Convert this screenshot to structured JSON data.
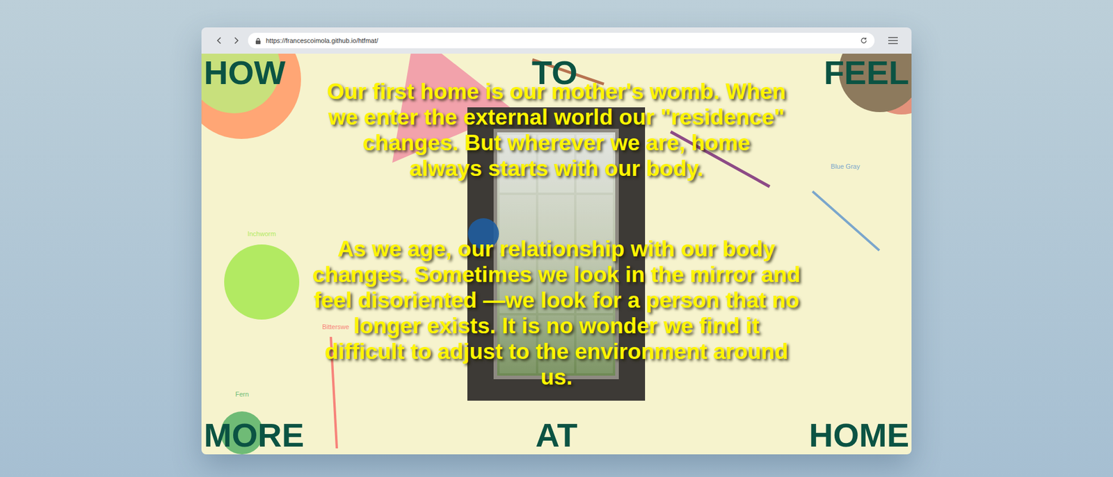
{
  "browser": {
    "url": "https://francescoimola.github.io/htfmat/"
  },
  "title_words": {
    "top": [
      "HOW",
      "TO",
      "FEEL"
    ],
    "bottom": [
      "MORE",
      "AT",
      "HOME"
    ]
  },
  "paragraphs": [
    "Our first home is our mother's womb. When we enter the external world our \"residence\" changes. But wherever we are, home always starts with our body.",
    "As we age, our relationship with our body changes. Sometimes we look in the mirror and feel disoriented —we look for a person that no longer exists. It is no wonder we find it difficult to adjust to the environment around us."
  ],
  "shapes": [
    {
      "label": "Inchworm",
      "kind": "circle",
      "color": "#b2ea62"
    },
    {
      "label": "Blue Gray",
      "kind": "line",
      "color": "#7aa6cc"
    },
    {
      "label": "Bitterswe",
      "kind": "line",
      "color": "#f7837a"
    },
    {
      "label": "Fern",
      "kind": "circle",
      "color": "#6fbb76"
    }
  ]
}
